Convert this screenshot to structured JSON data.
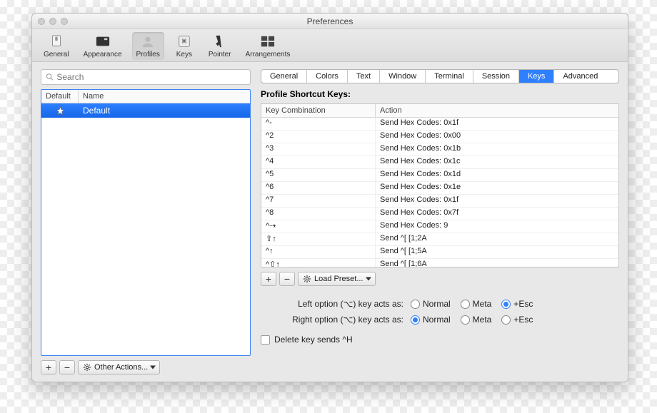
{
  "window": {
    "title": "Preferences"
  },
  "toolbar": {
    "items": [
      "General",
      "Appearance",
      "Profiles",
      "Keys",
      "Pointer",
      "Arrangements"
    ],
    "selectedIndex": 2
  },
  "search": {
    "placeholder": "Search"
  },
  "profiles": {
    "headers": [
      "Default",
      "Name"
    ],
    "rows": [
      {
        "name": "Default",
        "starred": true,
        "selected": true
      }
    ],
    "otherActionsLabel": "Other Actions..."
  },
  "tabs": {
    "items": [
      "General",
      "Colors",
      "Text",
      "Window",
      "Terminal",
      "Session",
      "Keys",
      "Advanced"
    ],
    "selectedIndex": 6
  },
  "keys": {
    "title": "Profile Shortcut Keys:",
    "headers": [
      "Key Combination",
      "Action"
    ],
    "rows": [
      {
        "combo": "^-",
        "action": "Send Hex Codes: 0x1f"
      },
      {
        "combo": "^2",
        "action": "Send Hex Codes: 0x00"
      },
      {
        "combo": "^3",
        "action": "Send Hex Codes: 0x1b"
      },
      {
        "combo": "^4",
        "action": "Send Hex Codes: 0x1c"
      },
      {
        "combo": "^5",
        "action": "Send Hex Codes: 0x1d"
      },
      {
        "combo": "^6",
        "action": "Send Hex Codes: 0x1e"
      },
      {
        "combo": "^7",
        "action": "Send Hex Codes: 0x1f"
      },
      {
        "combo": "^8",
        "action": "Send Hex Codes: 0x7f"
      },
      {
        "combo": "^⇢",
        "action": "Send Hex Codes: 9"
      },
      {
        "combo": "⇧↑",
        "action": "Send ^[ [1;2A"
      },
      {
        "combo": "^↑",
        "action": "Send ^[ [1;5A"
      },
      {
        "combo": "^⇧↑",
        "action": "Send ^[ [1;6A"
      }
    ],
    "loadPresetLabel": "Load Preset..."
  },
  "options": {
    "leftLabel": "Left option (⌥) key acts as:",
    "rightLabel": "Right option (⌥) key acts as:",
    "choices": [
      "Normal",
      "Meta",
      "+Esc"
    ],
    "leftSelected": 2,
    "rightSelected": 0
  },
  "deleteKey": {
    "label": "Delete key sends ^H",
    "checked": false
  }
}
